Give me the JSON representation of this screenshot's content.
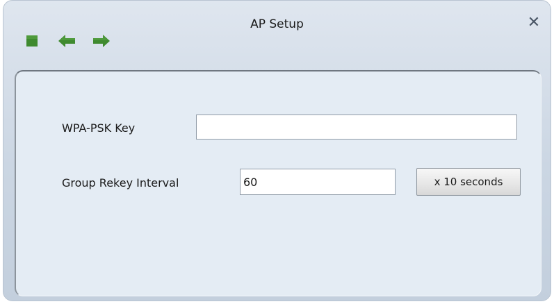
{
  "window": {
    "title": "AP Setup",
    "close_symbol": "✕"
  },
  "toolbar": {
    "items": [
      {
        "icon": "stop-square-icon",
        "color": "#3f8a2f"
      },
      {
        "icon": "arrow-left-icon",
        "color": "#3f8a2f"
      },
      {
        "icon": "arrow-right-icon",
        "color": "#3f8a2f"
      }
    ]
  },
  "form": {
    "wpa_psk_key": {
      "label": "WPA-PSK Key",
      "value": ""
    },
    "group_rekey_interval": {
      "label": "Group Rekey Interval",
      "value": "60",
      "unit_button_label": "x 10 seconds"
    }
  },
  "colors": {
    "accent_green": "#3f8a2f",
    "panel_background": "#e4ecf4",
    "titlebar_background": "#cbd6e3"
  }
}
